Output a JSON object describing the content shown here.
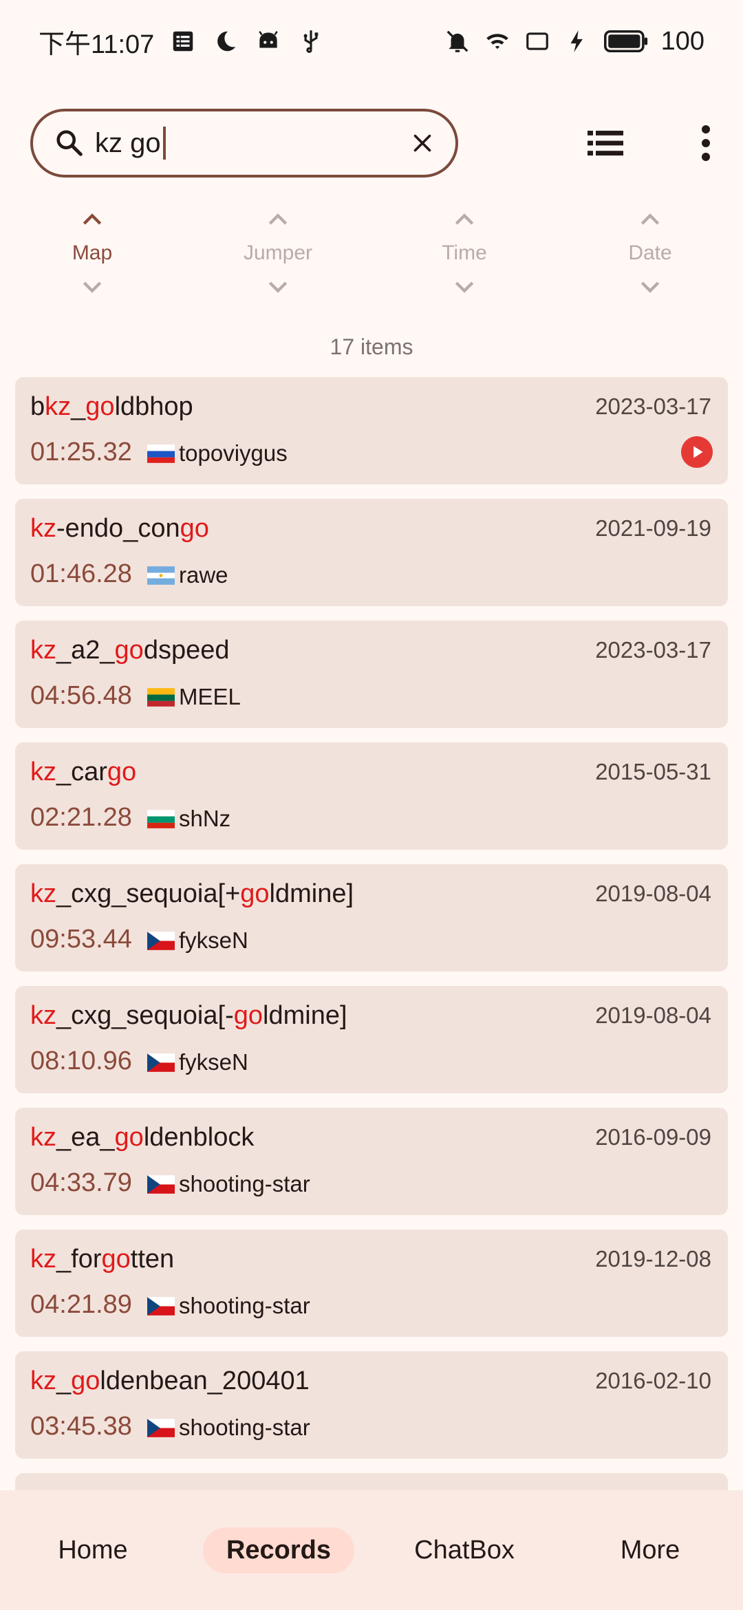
{
  "status_bar": {
    "time": "下午11:07",
    "battery": "100",
    "icons_left": [
      "notes-icon",
      "moon-icon",
      "android-icon",
      "usb-icon"
    ],
    "icons_right": [
      "mute-icon",
      "wifi-icon",
      "cast-icon",
      "charging-icon",
      "battery-icon"
    ]
  },
  "search": {
    "value": "kz go",
    "clear_icon": "close-icon",
    "search_icon": "search-icon"
  },
  "toolbar": {
    "list_icon": "list-view-icon",
    "menu_icon": "more-vert-icon"
  },
  "sort": {
    "columns": [
      {
        "label": "Map",
        "active": true
      },
      {
        "label": "Jumper",
        "active": false
      },
      {
        "label": "Time",
        "active": false
      },
      {
        "label": "Date",
        "active": false
      }
    ]
  },
  "items_count": "17 items",
  "records": [
    {
      "map_parts": [
        {
          "t": "b",
          "hl": false
        },
        {
          "t": "kz",
          "hl": true
        },
        {
          "t": "_",
          "hl": false
        },
        {
          "t": "go",
          "hl": true
        },
        {
          "t": "ldbhop",
          "hl": false
        }
      ],
      "date": "2023-03-17",
      "time": "01:25.32",
      "player": "topoviygus",
      "flag": "ru",
      "has_video": true
    },
    {
      "map_parts": [
        {
          "t": "kz",
          "hl": true
        },
        {
          "t": "-endo_con",
          "hl": false
        },
        {
          "t": "go",
          "hl": true
        }
      ],
      "date": "2021-09-19",
      "time": "01:46.28",
      "player": "rawe",
      "flag": "ar",
      "has_video": false
    },
    {
      "map_parts": [
        {
          "t": "kz",
          "hl": true
        },
        {
          "t": "_a2_",
          "hl": false
        },
        {
          "t": "go",
          "hl": true
        },
        {
          "t": "dspeed",
          "hl": false
        }
      ],
      "date": "2023-03-17",
      "time": "04:56.48",
      "player": "MEEL",
      "flag": "lt",
      "has_video": false
    },
    {
      "map_parts": [
        {
          "t": "kz",
          "hl": true
        },
        {
          "t": "_car",
          "hl": false
        },
        {
          "t": "go",
          "hl": true
        }
      ],
      "date": "2015-05-31",
      "time": "02:21.28",
      "player": "shNz",
      "flag": "bg",
      "has_video": false
    },
    {
      "map_parts": [
        {
          "t": "kz",
          "hl": true
        },
        {
          "t": "_cxg_sequoia[+",
          "hl": false
        },
        {
          "t": "go",
          "hl": true
        },
        {
          "t": "ldmine]",
          "hl": false
        }
      ],
      "date": "2019-08-04",
      "time": "09:53.44",
      "player": "fykseN",
      "flag": "cz",
      "has_video": false
    },
    {
      "map_parts": [
        {
          "t": "kz",
          "hl": true
        },
        {
          "t": "_cxg_sequoia[-",
          "hl": false
        },
        {
          "t": "go",
          "hl": true
        },
        {
          "t": "ldmine]",
          "hl": false
        }
      ],
      "date": "2019-08-04",
      "time": "08:10.96",
      "player": "fykseN",
      "flag": "cz",
      "has_video": false
    },
    {
      "map_parts": [
        {
          "t": "kz",
          "hl": true
        },
        {
          "t": "_ea_",
          "hl": false
        },
        {
          "t": "go",
          "hl": true
        },
        {
          "t": "ldenblock",
          "hl": false
        }
      ],
      "date": "2016-09-09",
      "time": "04:33.79",
      "player": "shooting-star",
      "flag": "cz",
      "has_video": false
    },
    {
      "map_parts": [
        {
          "t": "kz",
          "hl": true
        },
        {
          "t": "_for",
          "hl": false
        },
        {
          "t": "go",
          "hl": true
        },
        {
          "t": "tten",
          "hl": false
        }
      ],
      "date": "2019-12-08",
      "time": "04:21.89",
      "player": "shooting-star",
      "flag": "cz",
      "has_video": false
    },
    {
      "map_parts": [
        {
          "t": "kz",
          "hl": true
        },
        {
          "t": "_",
          "hl": false
        },
        {
          "t": "go",
          "hl": true
        },
        {
          "t": "ldenbean_200401",
          "hl": false
        }
      ],
      "date": "2016-02-10",
      "time": "03:45.38",
      "player": "shooting-star",
      "flag": "cz",
      "has_video": false
    }
  ],
  "nav": [
    {
      "label": "Home",
      "active": false
    },
    {
      "label": "Records",
      "active": true
    },
    {
      "label": "ChatBox",
      "active": false
    },
    {
      "label": "More",
      "active": false
    }
  ],
  "colors": {
    "accent": "#7b4a3c",
    "highlight": "#e01a1a",
    "card_bg": "#f2e2dc",
    "time_text": "#8b4a3a"
  }
}
